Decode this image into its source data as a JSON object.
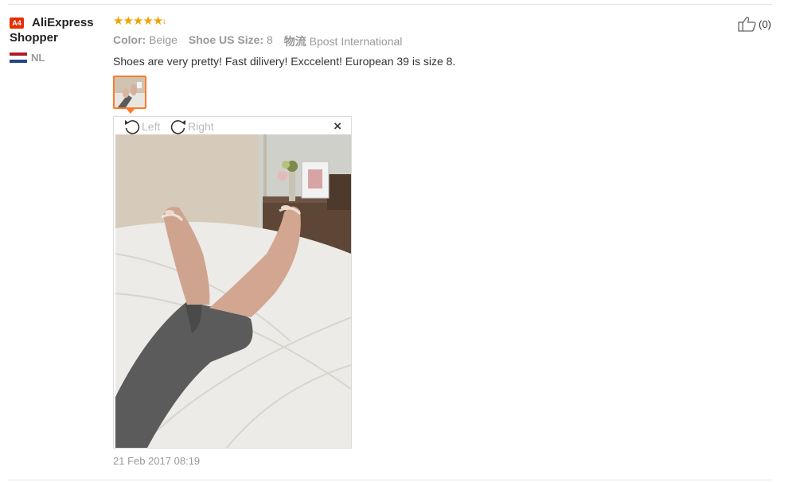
{
  "user": {
    "badge": "A4",
    "name_line1": "AliExpress",
    "name_line2": "Shopper",
    "country_code": "NL",
    "flag_colors": [
      "#ae1c28",
      "#ffffff",
      "#21468b"
    ]
  },
  "review": {
    "rating": 5,
    "attributes": [
      {
        "label": "Color:",
        "value": "Beige"
      },
      {
        "label": "Shoe US Size:",
        "value": "8"
      },
      {
        "label": "物流",
        "value": "Bpost International"
      }
    ],
    "text": "Shoes are very pretty! Fast dilivery! Exccelent! European 39 is size 8.",
    "date": "21 Feb 2017 08:19"
  },
  "viewer": {
    "rotate_left_label": "Left",
    "rotate_right_label": "Right",
    "close_glyph": "×"
  },
  "helpful": {
    "icon": "thumbs-up-icon",
    "count": "(0)"
  },
  "colors": {
    "star": "#f0a400",
    "thumb_border": "#ff7a2b",
    "badge": "#e62e04"
  }
}
